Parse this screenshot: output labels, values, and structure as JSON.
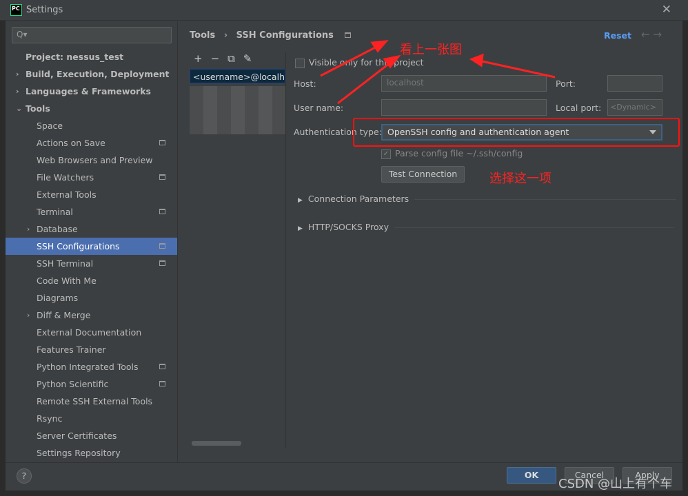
{
  "window": {
    "title": "Settings",
    "logo": "PC",
    "close_icon": "close-icon"
  },
  "search": {
    "placeholder": "Q▾"
  },
  "sidebar": {
    "items": [
      {
        "label": "Project: nessus_test",
        "bold": true,
        "level": 0
      },
      {
        "label": "Build, Execution, Deployment",
        "bold": true,
        "level": 0,
        "chevron": "›"
      },
      {
        "label": "Languages & Frameworks",
        "bold": true,
        "level": 0,
        "chevron": "›"
      },
      {
        "label": "Tools",
        "bold": true,
        "level": 0,
        "chevron": "⌄"
      },
      {
        "label": "Space",
        "level": 1
      },
      {
        "label": "Actions on Save",
        "level": 1,
        "project_icon": true
      },
      {
        "label": "Web Browsers and Preview",
        "level": 1
      },
      {
        "label": "File Watchers",
        "level": 1,
        "project_icon": true
      },
      {
        "label": "External Tools",
        "level": 1
      },
      {
        "label": "Terminal",
        "level": 1,
        "project_icon": true
      },
      {
        "label": "Database",
        "level": 1,
        "chevron": "›"
      },
      {
        "label": "SSH Configurations",
        "level": 1,
        "project_icon": true,
        "selected": true
      },
      {
        "label": "SSH Terminal",
        "level": 1,
        "project_icon": true
      },
      {
        "label": "Code With Me",
        "level": 1
      },
      {
        "label": "Diagrams",
        "level": 1
      },
      {
        "label": "Diff & Merge",
        "level": 1,
        "chevron": "›"
      },
      {
        "label": "External Documentation",
        "level": 1
      },
      {
        "label": "Features Trainer",
        "level": 1
      },
      {
        "label": "Python Integrated Tools",
        "level": 1,
        "project_icon": true
      },
      {
        "label": "Python Scientific",
        "level": 1,
        "project_icon": true
      },
      {
        "label": "Remote SSH External Tools",
        "level": 1
      },
      {
        "label": "Rsync",
        "level": 1
      },
      {
        "label": "Server Certificates",
        "level": 1
      },
      {
        "label": "Settings Repository",
        "level": 1
      }
    ]
  },
  "header": {
    "breadcrumb_parent": "Tools",
    "separator": "›",
    "breadcrumb_current": "SSH Configurations",
    "reset": "Reset",
    "back": "←",
    "forward": "→"
  },
  "list": {
    "toolbar": {
      "add": "+",
      "remove": "−",
      "copy": "⧉",
      "edit": "✎"
    },
    "items": [
      "<username>@localhost"
    ]
  },
  "form": {
    "visible_only": "Visible only for this project",
    "visible_only_checked": false,
    "host_label": "Host:",
    "host_value": "localhost",
    "port_label": "Port:",
    "port_value": "",
    "username_label": "User name:",
    "username_value": "",
    "localport_label": "Local port:",
    "localport_placeholder": "<Dynamic>",
    "auth_label": "Authentication type:",
    "auth_value": "OpenSSH config and authentication agent",
    "parse_config": "Parse config file ~/.ssh/config",
    "parse_config_checked": true,
    "test_connection": "Test Connection",
    "section1": "Connection Parameters",
    "section2": "HTTP/SOCKS Proxy"
  },
  "annotations": {
    "top": "看上一张图",
    "right": "选择这一项",
    "color": "#ff2222"
  },
  "footer": {
    "help": "?",
    "ok": "OK",
    "cancel": "Cancel",
    "apply": "Apply"
  },
  "watermark": "CSDN @山上有个车"
}
